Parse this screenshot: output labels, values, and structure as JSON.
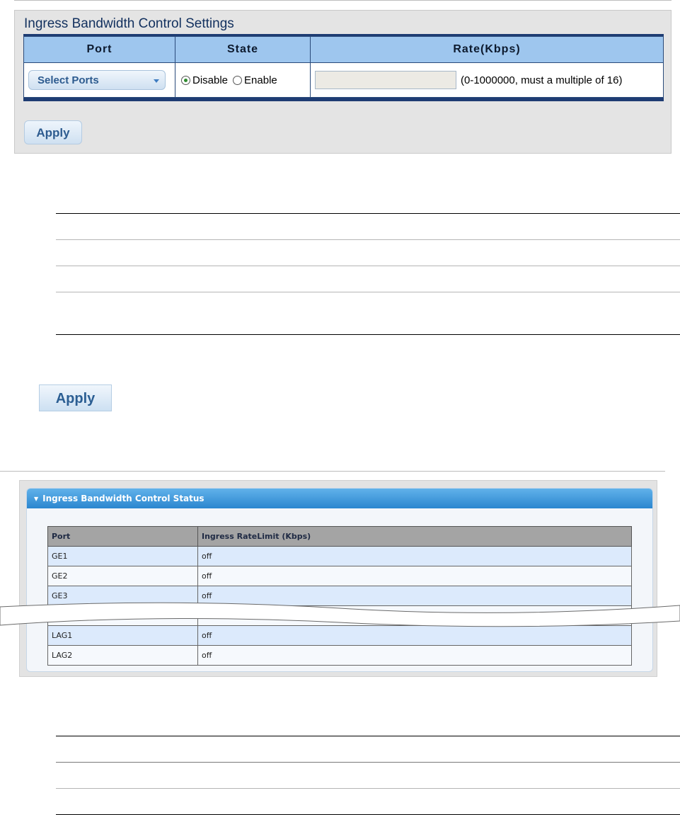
{
  "settings": {
    "title": "Ingress Bandwidth Control Settings",
    "columns": {
      "port": "Port",
      "state": "State",
      "rate": "Rate(Kbps)"
    },
    "port_select": "Select Ports",
    "state_options": {
      "disable": "Disable",
      "enable": "Enable",
      "selected": "Disable"
    },
    "rate_value": "",
    "rate_hint": "(0-1000000, must a multiple of 16)",
    "apply_label": "Apply"
  },
  "apply_large_label": "Apply",
  "status": {
    "title": "Ingress Bandwidth Control Status",
    "columns": {
      "port": "Port",
      "limit": "Ingress RateLimit (Kbps)"
    },
    "rows": [
      {
        "port": "GE1",
        "limit": "off"
      },
      {
        "port": "GE2",
        "limit": "off"
      },
      {
        "port": "GE3",
        "limit": "off"
      },
      {
        "port": "",
        "limit": ""
      },
      {
        "port": "LAG1",
        "limit": "off"
      },
      {
        "port": "LAG2",
        "limit": "off"
      }
    ]
  },
  "colors": {
    "title_navy": "#12305e",
    "header_blue": "#9ec6ee",
    "status_header_blue": "#2b86cf"
  }
}
